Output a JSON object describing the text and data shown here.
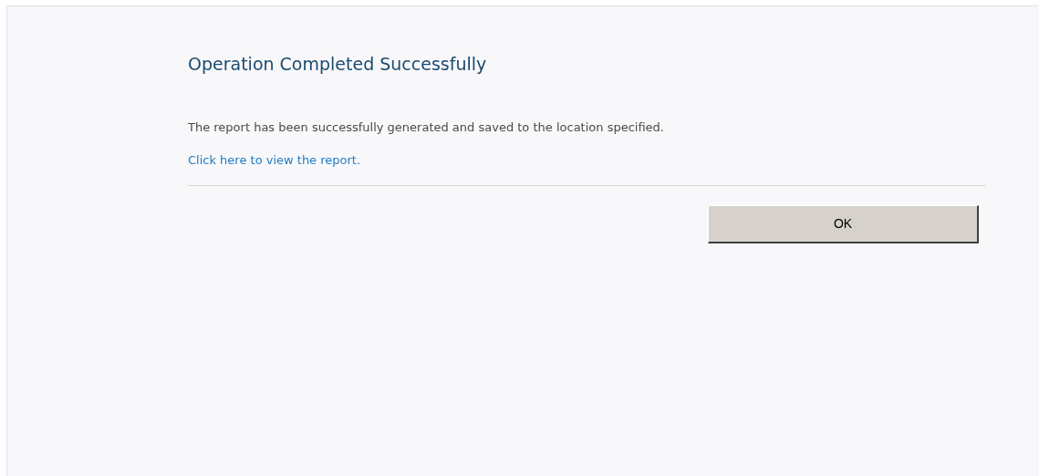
{
  "title": "Operation Completed Successfully",
  "message": "The report has been successfully generated and saved to the location specified.",
  "link": "Click here to view the report.",
  "buttons": [
    "OK"
  ]
}
